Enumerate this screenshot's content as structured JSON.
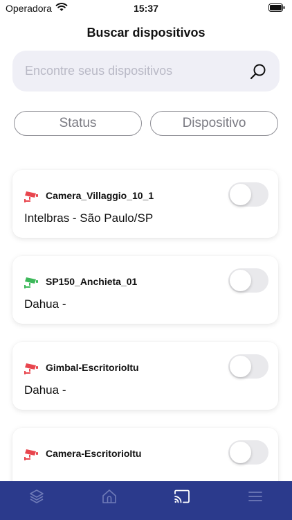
{
  "status_bar": {
    "carrier": "Operadora",
    "time": "15:37"
  },
  "header": {
    "title": "Buscar dispositivos"
  },
  "search": {
    "placeholder": "Encontre seus dispositivos",
    "value": ""
  },
  "filters": {
    "status_label": "Status",
    "device_label": "Dispositivo"
  },
  "devices": [
    {
      "name": "Camera_Villaggio_10_1",
      "subtitle": "Intelbras - São Paulo/SP",
      "status_color": "#e8464e",
      "enabled": false
    },
    {
      "name": "SP150_Anchieta_01",
      "subtitle": "Dahua -",
      "status_color": "#3db85a",
      "enabled": false
    },
    {
      "name": "Gimbal-EscritorioItu",
      "subtitle": "Dahua -",
      "status_color": "#e8464e",
      "enabled": false
    },
    {
      "name": "Camera-EscritorioItu",
      "subtitle": "",
      "status_color": "#e8464e",
      "enabled": false
    }
  ],
  "tabbar": {
    "background": "#2b3a8c",
    "tabs": [
      {
        "icon": "layers-icon",
        "active": false
      },
      {
        "icon": "home-icon",
        "active": false
      },
      {
        "icon": "cast-icon",
        "active": true
      },
      {
        "icon": "menu-icon",
        "active": false
      }
    ]
  }
}
